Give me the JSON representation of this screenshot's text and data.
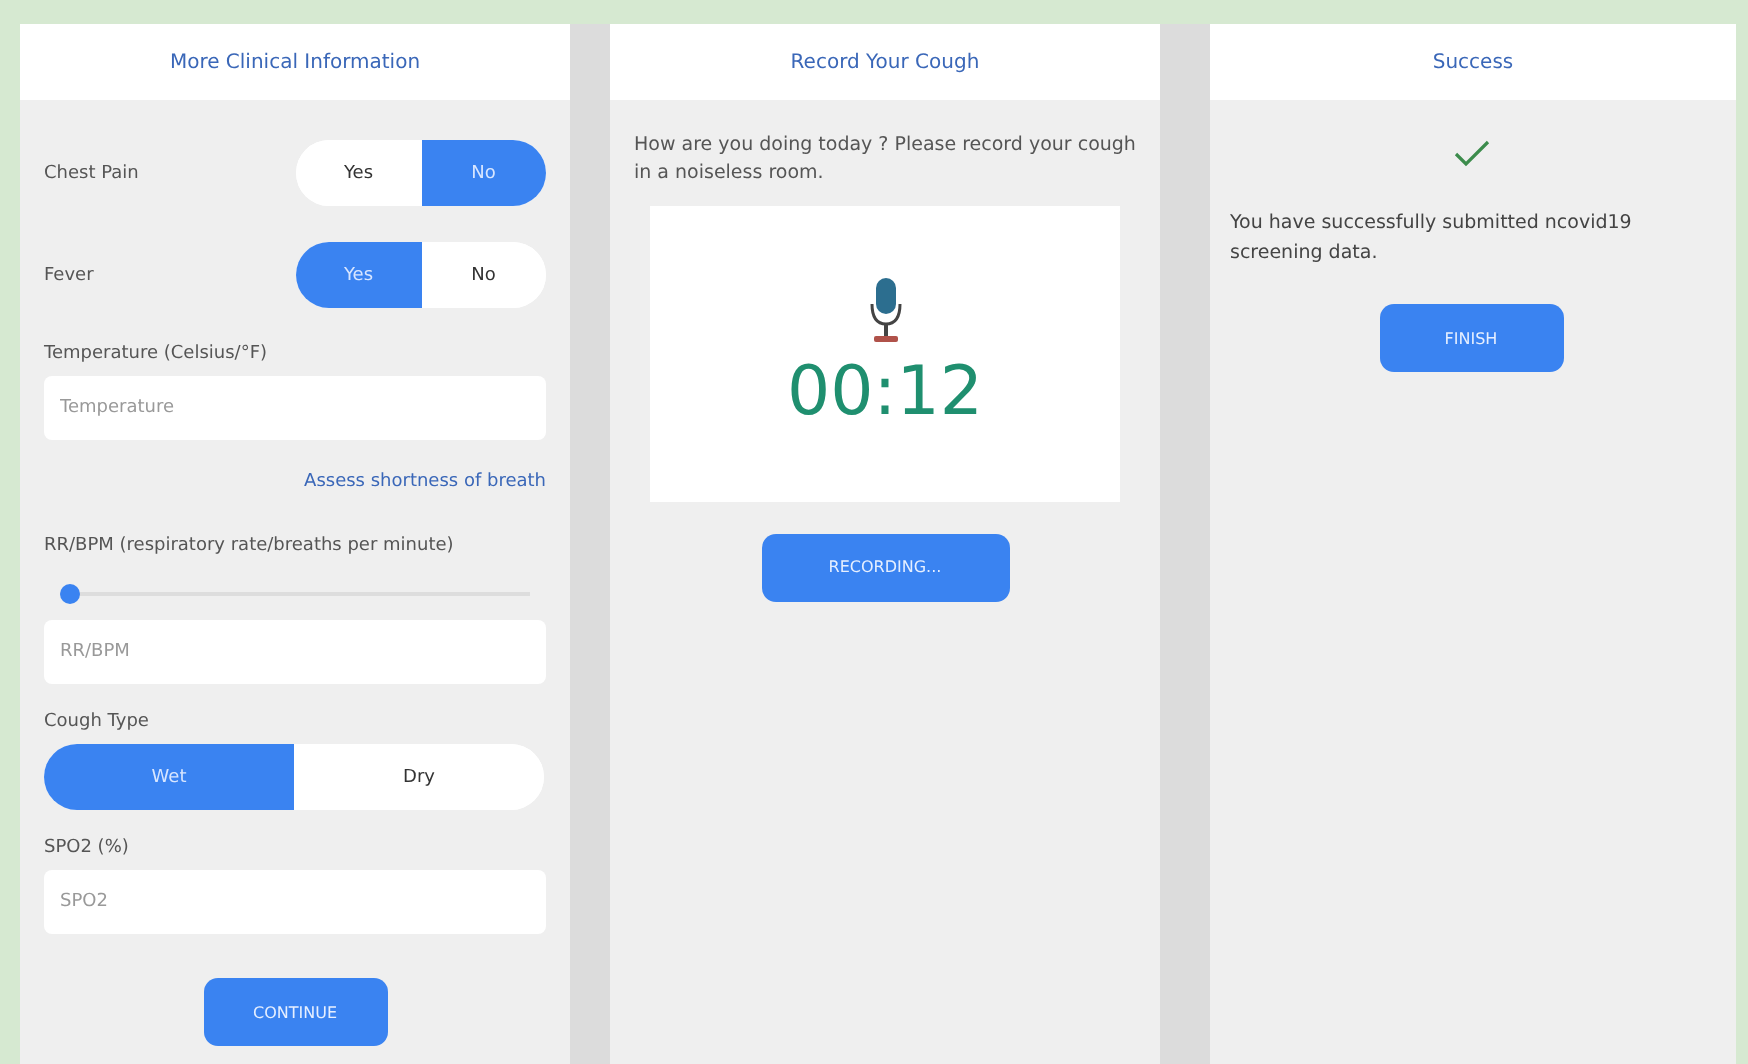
{
  "screens": [
    {
      "title": "More Clinical Information",
      "chest_pain": {
        "label": "Chest Pain",
        "options": [
          {
            "label": "Yes",
            "selected": false
          },
          {
            "label": "No",
            "selected": true
          }
        ]
      },
      "fever": {
        "label": "Fever",
        "options": [
          {
            "label": "Yes",
            "selected": true
          },
          {
            "label": "No",
            "selected": false
          }
        ]
      },
      "temperature": {
        "label": "Temperature (Celsius/°F)",
        "placeholder": "Temperature"
      },
      "assess_link": "Assess shortness of breath",
      "rr": {
        "label": "RR/BPM (respiratory rate/breaths per minute)",
        "level": 0.02,
        "placeholder": "RR/BPM"
      },
      "cough_type": {
        "label": "Cough Type",
        "options": [
          {
            "label": "Wet",
            "selected": true
          },
          {
            "label": "Dry",
            "selected": false
          }
        ]
      },
      "spo2": {
        "label": "SPO2 (%)",
        "placeholder": "SPO2"
      },
      "button": "CONTINUE"
    },
    {
      "title": "Record Your Cough",
      "prompt": "How are you doing today ? Please record your cough in a noiseless room.",
      "timer": "00:12",
      "button": "RECORDING..."
    },
    {
      "title": "Success",
      "message": "You have successfully submitted ncovid19 screening data.",
      "button": "FINISH"
    }
  ]
}
